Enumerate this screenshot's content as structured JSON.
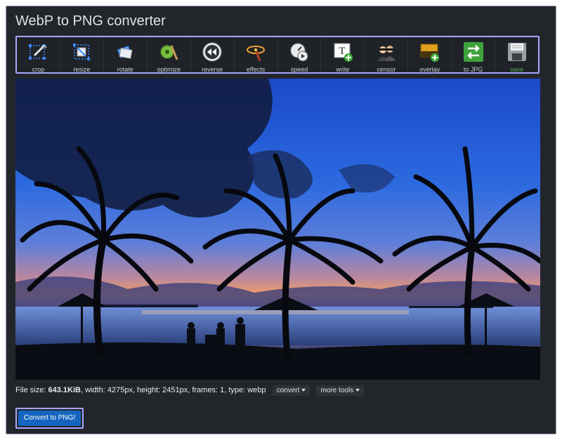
{
  "page": {
    "title": "WebP to PNG converter"
  },
  "toolbar": {
    "tools": [
      {
        "label": "crop",
        "icon": "crop-icon"
      },
      {
        "label": "resize",
        "icon": "resize-icon"
      },
      {
        "label": "rotate",
        "icon": "rotate-icon"
      },
      {
        "label": "optimize",
        "icon": "optimize-icon"
      },
      {
        "label": "reverse",
        "icon": "reverse-icon"
      },
      {
        "label": "effects",
        "icon": "effects-icon"
      },
      {
        "label": "speed",
        "icon": "speed-icon"
      },
      {
        "label": "write",
        "icon": "write-icon"
      },
      {
        "label": "censor",
        "icon": "censor-icon"
      },
      {
        "label": "overlay",
        "icon": "overlay-icon"
      },
      {
        "label": "to JPG",
        "icon": "to-jpg-icon"
      },
      {
        "label": "save",
        "icon": "save-icon"
      }
    ]
  },
  "file_info": {
    "size_label": "File size: ",
    "size_value": "643.1KiB",
    "details": ", width: 4275px, height: 2451px, frames: 1, type: webp"
  },
  "menus": {
    "convert_label": "convert",
    "more_tools_label": "more tools"
  },
  "actions": {
    "convert_button": "Convert to PNG!"
  },
  "colors": {
    "panel_bg": "#22262b",
    "accent_outline": "#a8a6ff",
    "primary_button": "#1565c0"
  }
}
